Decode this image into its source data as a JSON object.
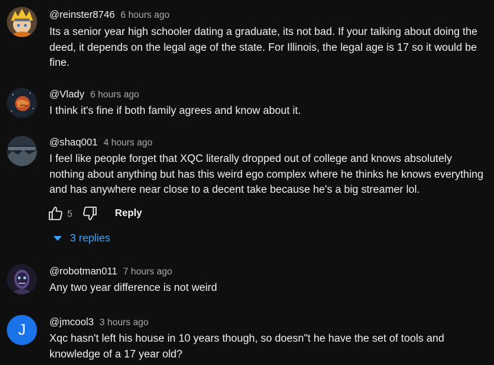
{
  "comments": [
    {
      "author": "@reinster8746",
      "time": "6 hours ago",
      "text": "Its a senior year high schooler dating a graduate, its not bad. If your talking about doing the deed, it depends on the legal age of the state. For Illinois, the legal age is 17 so it would be fine."
    },
    {
      "author": "@Vlady",
      "time": "6 hours ago",
      "text": "I think it's fine if both family agrees and know about it."
    },
    {
      "author": "@shaq001",
      "time": "4 hours ago",
      "text": "I feel like people forget that XQC literally dropped out of college and knows absolutely nothing about anything but has this weird ego complex where he thinks he knows everything and has anywhere near close to a decent take because he's a big streamer lol.",
      "likes": "5",
      "reply_label": "Reply",
      "replies_label": "3 replies"
    },
    {
      "author": "@robotman011",
      "time": "7 hours ago",
      "text": "Any two year difference is not weird"
    },
    {
      "author": "@jmcool3",
      "time": "3 hours ago",
      "text": "Xqc hasn't left his house in 10 years though, so doesn\"t he have the set of tools and knowledge of a 17 year old?",
      "avatar_letter": "J"
    }
  ],
  "colors": {
    "background": "#0f0f0f",
    "text": "#f1f1f1",
    "secondary": "#aaaaaa",
    "link": "#3ea6ff",
    "avatar_j": "#1a73e8"
  }
}
